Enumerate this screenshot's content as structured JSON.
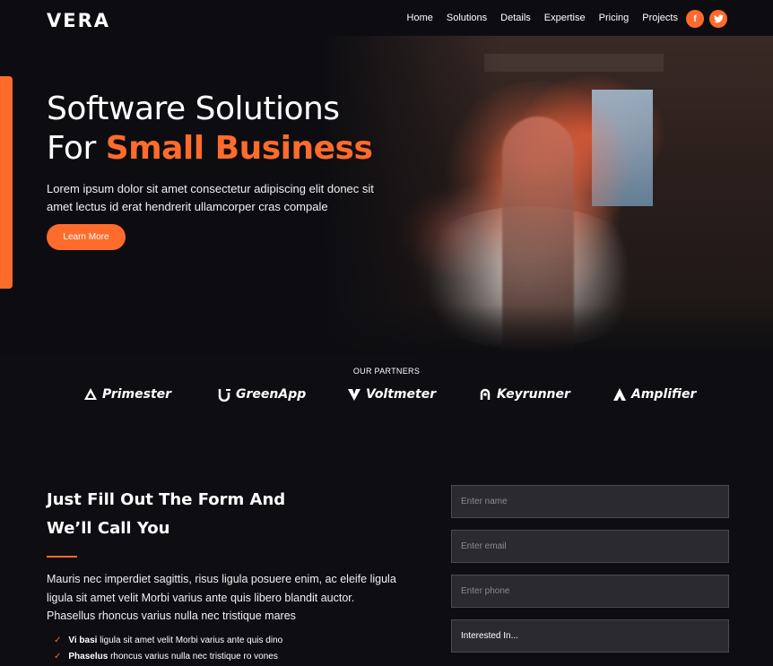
{
  "nav": {
    "logo": "VERA",
    "items": [
      "Home",
      "Solutions",
      "Details",
      "Expertise",
      "Pricing",
      "Projects"
    ],
    "social": [
      "f",
      "t"
    ]
  },
  "hero": {
    "title_line1": "Software Solutions",
    "title_line2_prefix": "For ",
    "title_line2_accent": "Small Business",
    "description": "Lorem ipsum dolor sit amet consectetur adipiscing elit donec sit amet lectus id erat hendrerit ullamcorper cras compale",
    "button": "Learn More"
  },
  "partners": {
    "title": "OUR PARTNERS",
    "logos": [
      "Primester",
      "GreenApp",
      "Voltmeter",
      "Keyrunner",
      "Amplifier"
    ]
  },
  "form_section": {
    "title_line1": "Just Fill Out The Form And",
    "title_line2": "We’ll Call You",
    "description": "Mauris nec imperdiet sagittis, risus ligula posuere enim, ac eleife ligula ligula sit amet velit Morbi varius ante quis libero blandit auctor. Phasellus rhoncus varius nulla nec tristique mares",
    "checklist": [
      {
        "bold": "Vi basi",
        "text": " ligula sit amet velit Morbi varius ante quis dino"
      },
      {
        "bold": "Phaselus",
        "text": " rhoncus varius nulla nec tristique ro vones"
      }
    ],
    "fields": {
      "name_placeholder": "Enter name",
      "email_placeholder": "Enter email",
      "phone_placeholder": "Enter phone",
      "interest_value": "Interested In..."
    }
  },
  "colors": {
    "accent": "#ff6b2c",
    "background": "#0e0e12",
    "field_bg": "#2a2a30"
  }
}
